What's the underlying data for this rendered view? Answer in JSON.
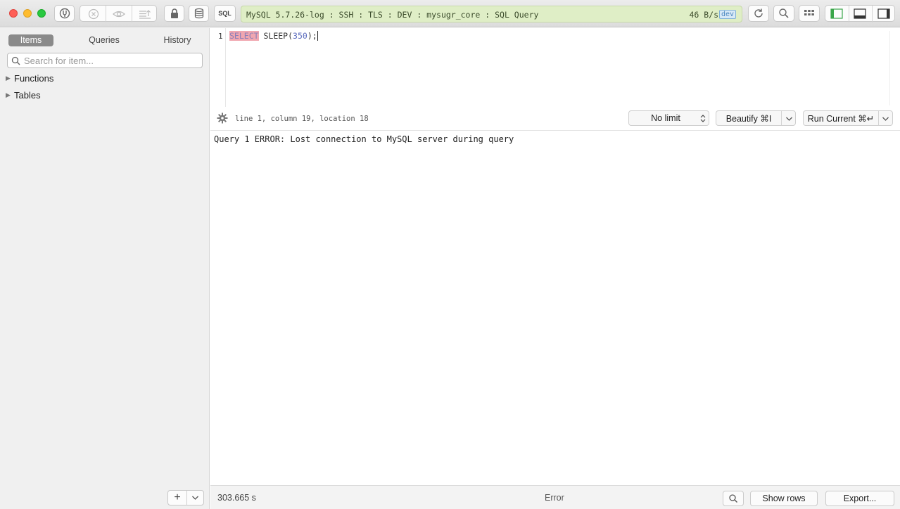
{
  "toolbar": {
    "connection": "MySQL 5.7.26-log : SSH : TLS : DEV : mysugr_core : SQL Query",
    "speed": "46 B/s",
    "env_badge": "dev",
    "sql_label": "SQL"
  },
  "sidebar": {
    "tabs": [
      {
        "label": "Items",
        "active": true
      },
      {
        "label": "Queries",
        "active": false
      },
      {
        "label": "History",
        "active": false
      }
    ],
    "search_placeholder": "Search for item...",
    "tree": [
      {
        "label": "Functions"
      },
      {
        "label": "Tables"
      }
    ],
    "add_label": "+"
  },
  "editor": {
    "line_number": "1",
    "keyword": "SELECT",
    "func": "SLEEP(",
    "arg": "350",
    "tail": ");"
  },
  "status": {
    "cursor_info": "line 1, column 19, location 18",
    "limit": "No limit",
    "beautify": "Beautify ⌘I",
    "run": "Run Current ⌘↵"
  },
  "results": {
    "message": "Query 1 ERROR: Lost connection to MySQL server during query"
  },
  "footer": {
    "elapsed": "303.665 s",
    "state": "Error",
    "show_rows": "Show rows",
    "export": "Export..."
  }
}
